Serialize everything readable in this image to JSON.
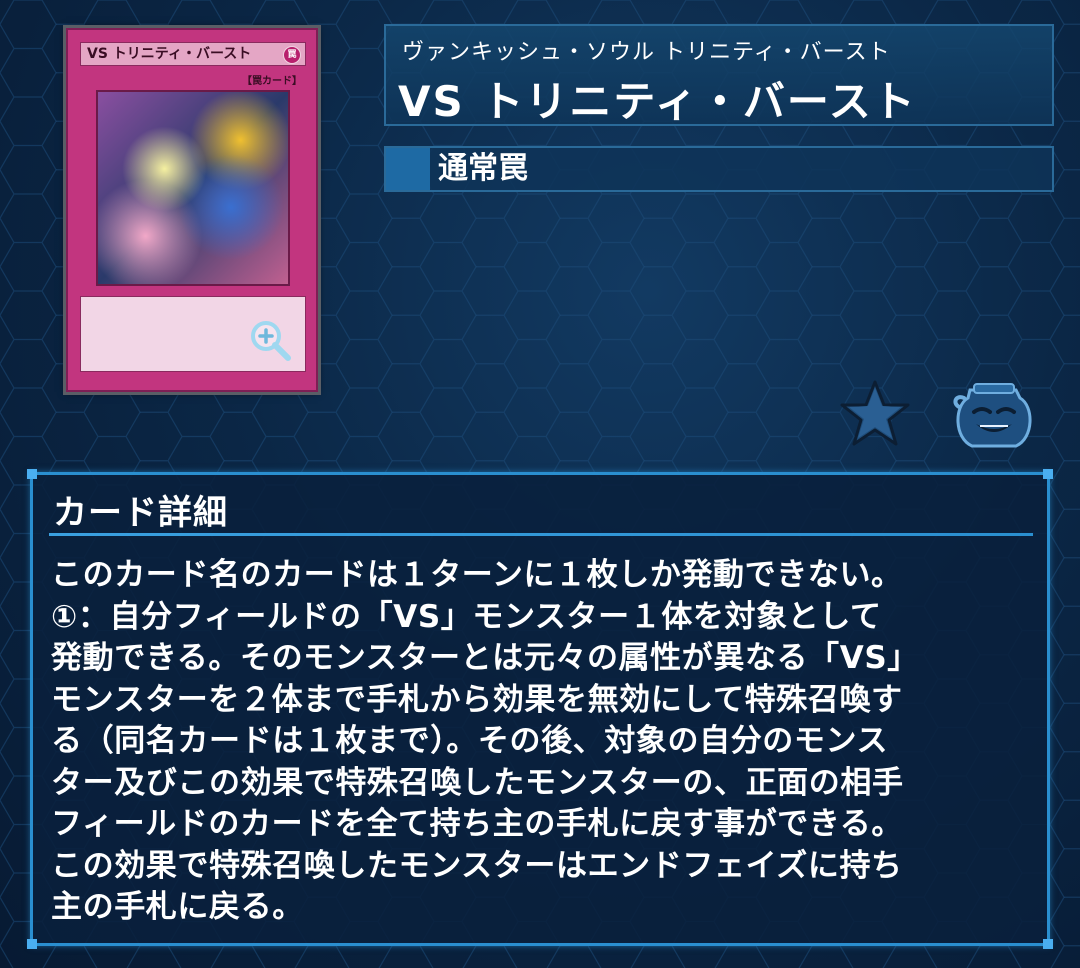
{
  "card": {
    "name_on_card": "VS トリニティ・バースト",
    "type_on_card": "【罠カード】",
    "attribute_glyph": "罠"
  },
  "header": {
    "ruby": "ヴァンキッシュ・ソウル トリニティ・バースト",
    "name": "VS トリニティ・バースト"
  },
  "type": {
    "label": "通常罠",
    "swatch_color": "#1e6aa4"
  },
  "icons": {
    "zoom": "zoom-in-icon",
    "favorite": "star-icon",
    "pot": "pot-of-greed-icon"
  },
  "detail": {
    "title": "カード詳細",
    "text": "このカード名のカードは１ターンに１枚しか発動できない。\n①：自分フィールドの「VS」モンスター１体を対象として\n発動できる。そのモンスターとは元々の属性が異なる「VS」\nモンスターを２体まで手札から効果を無効にして特殊召喚す\nる（同名カードは１枚まで）。その後、対象の自分のモンス\nター及びこの効果で特殊召喚したモンスターの、正面の相手\nフィールドのカードを全て持ち主の手札に戻す事ができる。\nこの効果で特殊召喚したモンスターはエンドフェイズに持ち\n主の手札に戻る。"
  },
  "colors": {
    "card_frame": "#c2357f",
    "panel_border": "#2a8fd0",
    "background": "#0b2746"
  }
}
